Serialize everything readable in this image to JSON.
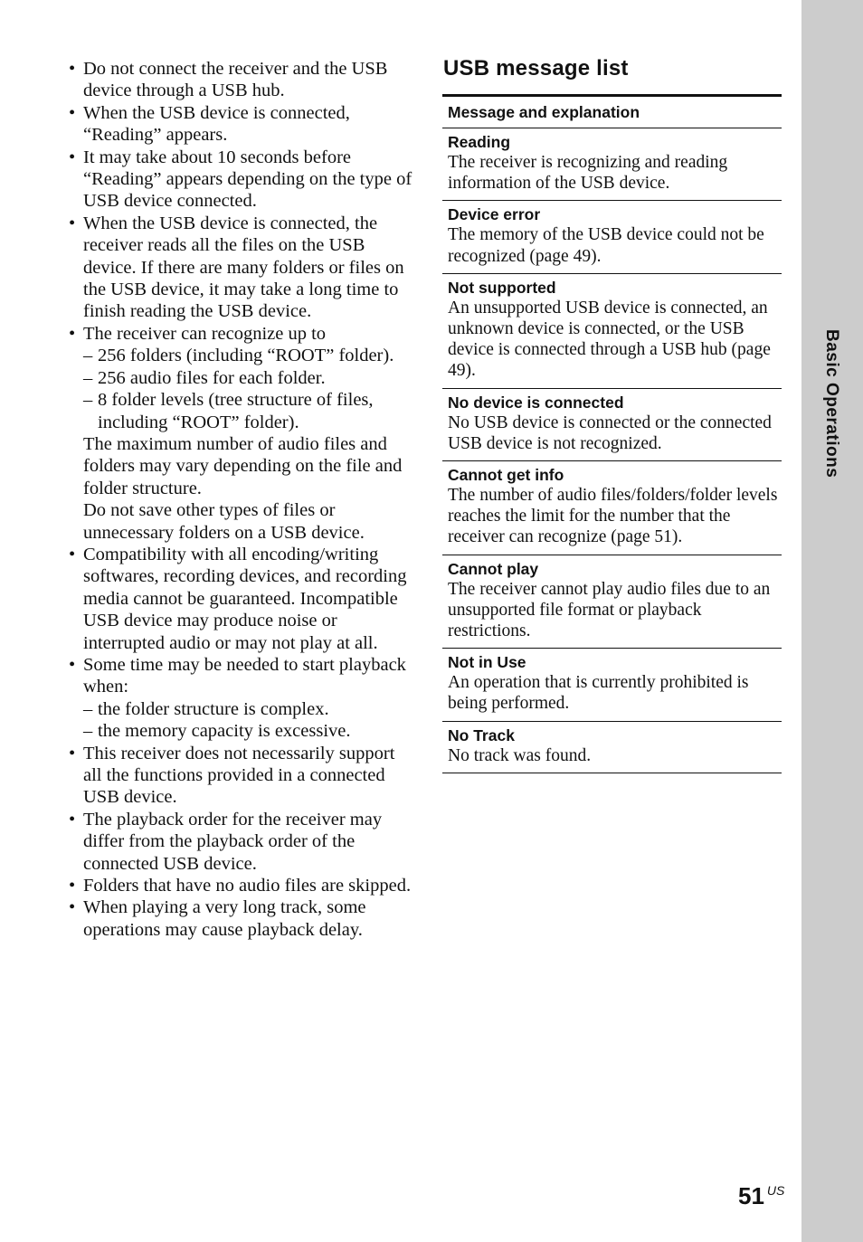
{
  "left_column": {
    "bullets": [
      {
        "text": "Do not connect the receiver and the USB device through a USB hub."
      },
      {
        "text": "When the USB device is connected, “Reading” appears."
      },
      {
        "text": "It may take about 10 seconds before “Reading” appears depending on the type of USB device connected."
      },
      {
        "text": "When the USB device is connected, the receiver reads all the files on the USB device. If there are many folders or files on the USB device, it may take a long time to finish reading the USB device."
      },
      {
        "text": "The receiver can recognize up to",
        "subitems": [
          "256 folders (including “ROOT” folder).",
          "256 audio files for each folder.",
          "8 folder levels (tree structure of files, including “ROOT” folder)."
        ],
        "paragraphs": [
          "The maximum number of audio files and folders may vary depending on the file and folder structure.",
          "Do not save other types of files or unnecessary folders on a USB device."
        ]
      },
      {
        "text": "Compatibility with all encoding/writing softwares, recording devices, and recording media cannot be guaranteed. Incompatible USB device may produce noise or interrupted audio or may not play at all."
      },
      {
        "text": "Some time may be needed to start playback when:",
        "subitems": [
          "the folder structure is complex.",
          "the memory capacity is excessive."
        ]
      },
      {
        "text": "This receiver does not necessarily support all the functions provided in a connected USB device."
      },
      {
        "text": "The playback order for the receiver may differ from the playback order of the connected USB device."
      },
      {
        "text": "Folders that have no audio files are skipped."
      },
      {
        "text": "When playing a very long track, some operations may cause playback delay."
      }
    ]
  },
  "usb_message_list": {
    "title": "USB message list",
    "header": "Message and explanation",
    "rows": [
      {
        "message": "Reading",
        "explanation": "The receiver is recognizing and reading information of the USB device."
      },
      {
        "message": "Device error",
        "explanation": "The memory of the USB device could not be recognized (page 49)."
      },
      {
        "message": "Not supported",
        "explanation": "An unsupported USB device is connected, an unknown device is connected, or the USB device is connected through a USB hub (page 49)."
      },
      {
        "message": "No device is connected",
        "explanation": "No USB device is connected or the connected USB device is not recognized."
      },
      {
        "message": "Cannot get info",
        "explanation": "The number of audio files/folders/folder levels reaches the limit for the number that the receiver can recognize (page 51)."
      },
      {
        "message": "Cannot play",
        "explanation": "The receiver cannot play audio files due to an unsupported file format or playback restrictions."
      },
      {
        "message": "Not in Use",
        "explanation": "An operation that is currently prohibited is being performed."
      },
      {
        "message": "No Track",
        "explanation": "No track was found."
      }
    ]
  },
  "side_tab": {
    "label": "Basic Operations",
    "color": "#cccccc"
  },
  "footer": {
    "page_number": "51",
    "region_suffix": "US"
  }
}
